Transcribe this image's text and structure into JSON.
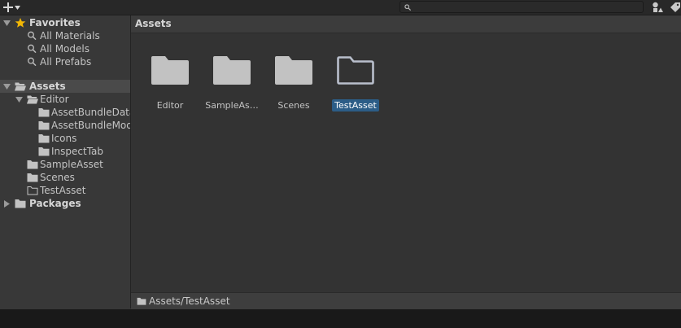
{
  "search": {
    "placeholder": "",
    "value": ""
  },
  "tree": {
    "favorites_label": "Favorites",
    "favorites": [
      "All Materials",
      "All Models",
      "All Prefabs"
    ],
    "assets_label": "Assets",
    "editor_label": "Editor",
    "editor_children": [
      "AssetBundleData",
      "AssetBundleModel",
      "Icons",
      "InspectTab"
    ],
    "sample_asset": "SampleAsset",
    "scenes": "Scenes",
    "test_asset": "TestAsset",
    "packages_label": "Packages"
  },
  "content": {
    "header": "Assets",
    "items": [
      {
        "label": "Editor",
        "selected": false
      },
      {
        "label": "SampleAs…",
        "selected": false
      },
      {
        "label": "Scenes",
        "selected": false
      },
      {
        "label": "TestAsset",
        "selected": true
      }
    ]
  },
  "footer": {
    "path": "Assets/TestAsset"
  },
  "colors": {
    "background": "#383838",
    "selection": "#2c5d87",
    "favorite_star": "#f2b705",
    "folder": "#c2c2c2"
  }
}
